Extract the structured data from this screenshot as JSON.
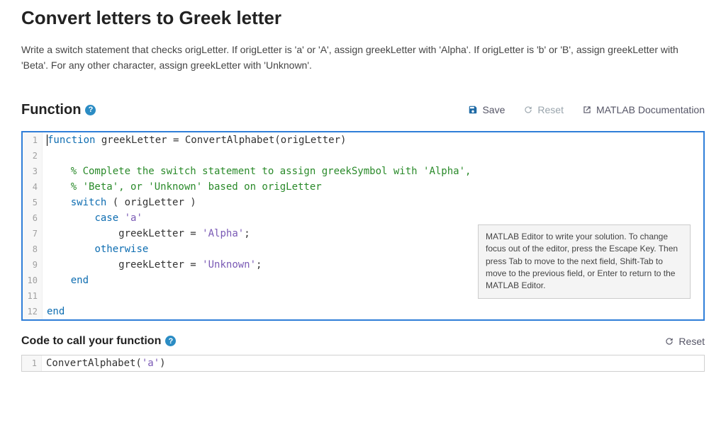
{
  "title": "Convert letters to Greek letter",
  "description": "Write a switch statement that checks origLetter. If origLetter is 'a' or 'A', assign greekLetter with 'Alpha'. If origLetter is 'b' or 'B', assign greekLetter with 'Beta'. For any other character, assign greekLetter with 'Unknown'.",
  "function_section": {
    "label": "Function",
    "help": "?"
  },
  "toolbar": {
    "save": "Save",
    "reset": "Reset",
    "docs": "MATLAB Documentation"
  },
  "code_lines": {
    "l1_kw": "function",
    "l1_rest": " greekLetter = ConvertAlphabet(origLetter)",
    "l3": "    % Complete the switch statement to assign greekSymbol with 'Alpha',",
    "l4": "    % 'Beta', or 'Unknown' based on origLetter",
    "l5_kw": "switch",
    "l5_rest": " ( origLetter )",
    "l6_kw": "case",
    "l6_str": "'a'",
    "l7_id": "greekLetter = ",
    "l7_str": "'Alpha'",
    "l7_semi": ";",
    "l8_kw": "otherwise",
    "l9_id": "greekLetter = ",
    "l9_str": "'Unknown'",
    "l9_semi": ";",
    "l10_kw": "end",
    "l12_kw": "end"
  },
  "tooltip": "MATLAB Editor to write your solution. To change focus out of the editor, press the Escape Key. Then press Tab to move to the next field, Shift-Tab to move to the previous field, or Enter to return to the MATLAB Editor.",
  "call_section": {
    "label": "Code to call your function",
    "help": "?",
    "reset": "Reset"
  },
  "call_code": {
    "l1_a": "ConvertAlphabet(",
    "l1_str": "'a'",
    "l1_b": ")"
  },
  "gutters": {
    "n1": "1",
    "n2": "2",
    "n3": "3",
    "n4": "4",
    "n5": "5",
    "n6": "6",
    "n7": "7",
    "n8": "8",
    "n9": "9",
    "n10": "10",
    "n11": "11",
    "n12": "12"
  }
}
